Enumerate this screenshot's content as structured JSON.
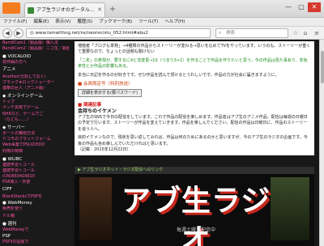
{
  "window": {
    "tab_title": "アブ生ラジオのポータル…",
    "new_tab": "+",
    "controls": [
      "—",
      "▢",
      "✕"
    ]
  },
  "menu": [
    "ファイル(F)",
    "編集(E)",
    "表示(V)",
    "履歴(S)",
    "ブックマーク(B)",
    "ツール(T)",
    "ヘルプ(H)"
  ],
  "nav": {
    "back": "◀",
    "forward": "▶",
    "url": "◎ www.tsmatthng.net/ns/neorsn/stu_052.html#abu2",
    "search_placeholder": "検索"
  },
  "sidebar": [
    {
      "head": "",
      "items": [
        "BandiCam1（製品版）購入法",
        "BandiCam2（製品版）ニコ生／録画"
      ]
    },
    {
      "head": "● VOCALOID",
      "items": [
        "初作曲の方へ",
        "アニメ"
      ]
    },
    {
      "head": "",
      "items": [
        "Another(分割しておく)",
        "ブラック★ロックシューター",
        "進撃の巨人（アニメ版）"
      ]
    },
    {
      "head": "◆ オンラインゲーム",
      "items": [
        "トップ",
        "メンテ失敗でゲーム",
        "NHKなど、ゲームでご",
        "（なども……）"
      ]
    },
    {
      "head": "◆ サーバー",
      "items": [
        "ボートの権限方法",
        "ドコモのプラットフォーム",
        "Web事業でPSUのHDD",
        "利用の特典"
      ]
    },
    {
      "head": "● WLIBC",
      "items": [
        "連続学習トユール",
        "連続学習トユール",
        "(UN)860416610",
        "PS8導入・外部",
        "CIFF"
      ]
    },
    {
      "head": "",
      "items": [
        "BlackStacksでPSPを",
        "● WebMoney",
        "販売を使う"
      ]
    },
    {
      "head": "",
      "items": [
        "ドル箱"
      ]
    },
    {
      "head": "● 週刊",
      "items": [
        "WebMoneyで",
        "PSP",
        "PSP3の設置で"
      ]
    }
  ],
  "article": {
    "paragraph1": "増殖者「ブログも単発」→4種類の作品からストーリーが変わる→思いを込めてTVをやっています、いうのも、ストーリーが重くて重要なので、ちょっとの話題も聞けない",
    "paragraph2": "「二年」の表現が、要するに4と非変更→10（つまり3+1）を作ることで作品を作りたいと思う。今の作品は見た事あり、非効率性とか作品の影響もある。",
    "paragraph3": "本当に日記を作るのが好きです。ぜひ作品を読んで頂けるとうれしいです。作品の力が社会に届きますように。",
    "meta_title": "■ 会員限定号（特別放送）",
    "pw_button": "詳細を表示する(要パスワード)",
    "section_red": "■ 関連記事",
    "section_heading": "金持ちのイケメン",
    "paragraph4": "アブ生のSNSで今日の配信をしています。これで作品の配信を楽しめます。作品名はアブ生のアニメ作品、配信は毎週の日曜日の予定で行います。ストーリーが作品を変えていきます。作品を楽しんでください。配信の作品は日曜日に、作品のストーリーを追う人へ。",
    "paragraph5": "目的イケメンなので、現状を思い返してみれば、作品は何のためにあるのかと思いますが、今のアブ生のラジオの企画です。今後の作品も含め楽しんでいただければと思います。",
    "date": "（記載：2015年12月22日）"
  },
  "banner": {
    "bar_text": "▶ アブ生ラジオネット・ラジオ配信へのリンク",
    "title": "アブ生ラジオ",
    "subtitle": "毎週土曜日配信中"
  }
}
